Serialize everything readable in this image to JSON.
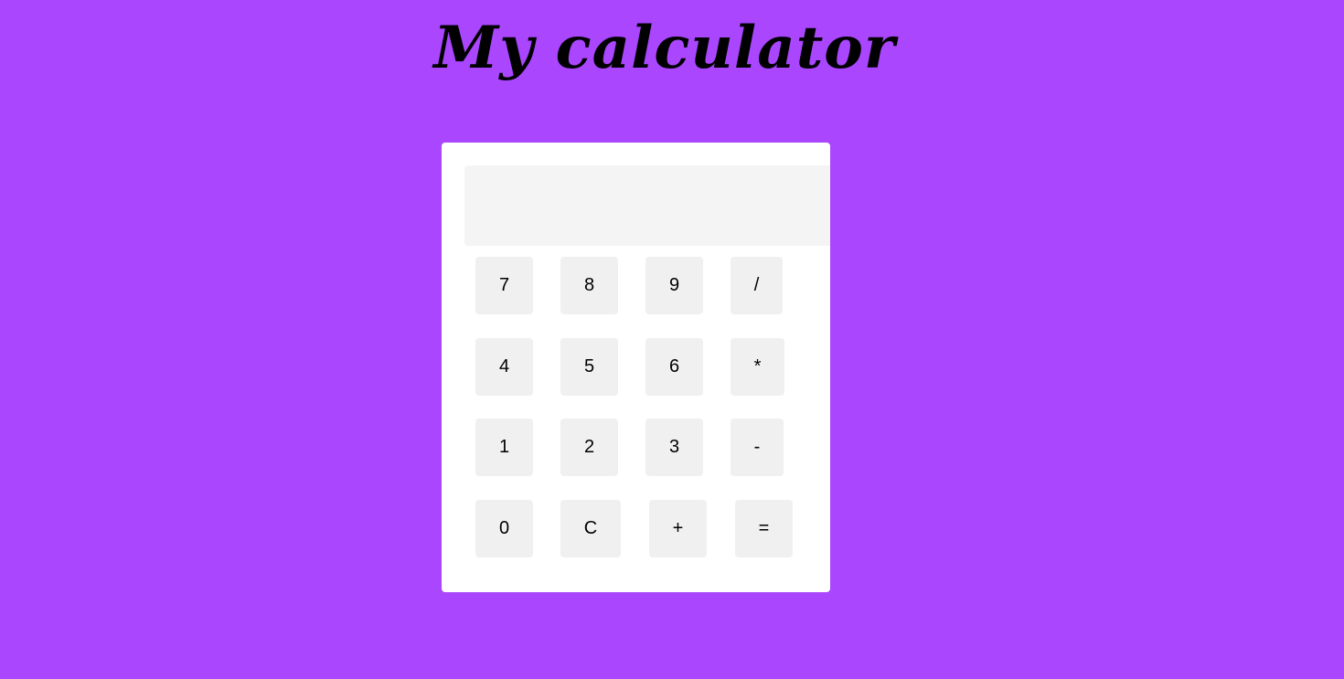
{
  "page": {
    "title": "My calculator",
    "background_color": "#a946fe"
  },
  "calculator": {
    "display_value": "",
    "keys": {
      "seven": "7",
      "eight": "8",
      "nine": "9",
      "divide": "/",
      "four": "4",
      "five": "5",
      "six": "6",
      "multiply": "*",
      "one": "1",
      "two": "2",
      "three": "3",
      "subtract": "-",
      "zero": "0",
      "clear": "C",
      "add": "+",
      "equals": "="
    },
    "panel_color": "#ffffff",
    "display_color": "#f4f4f4",
    "key_color": "#f0f0f0"
  }
}
